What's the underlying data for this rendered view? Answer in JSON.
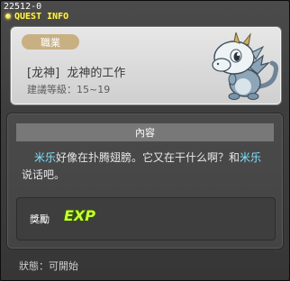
{
  "window": {
    "quest_id": "22512-0",
    "title": "QUEST INFO"
  },
  "quest": {
    "job_badge": "職業",
    "name_prefix": "[龙神]",
    "name": "龙神的工作",
    "level_text": "建議等級：15~19"
  },
  "content": {
    "header": "內容",
    "dialog": {
      "npc_name_1": "米乐",
      "text_1": "好像在扑腾翅膀。它又在干什么啊？和",
      "npc_name_2": "米乐",
      "text_2": "说话吧。"
    },
    "reward": {
      "label": "獎勵",
      "exp_icon": "EXP"
    }
  },
  "status": {
    "text": "狀態：可開始"
  },
  "colors": {
    "title": "#fff35a",
    "npc_name": "#7fe4ff",
    "badge": "#c8b083",
    "exp": "#c8ff3a"
  },
  "icons": {
    "title_marker": "yellow-dot-icon",
    "npc": "baby-dragon-portrait"
  }
}
